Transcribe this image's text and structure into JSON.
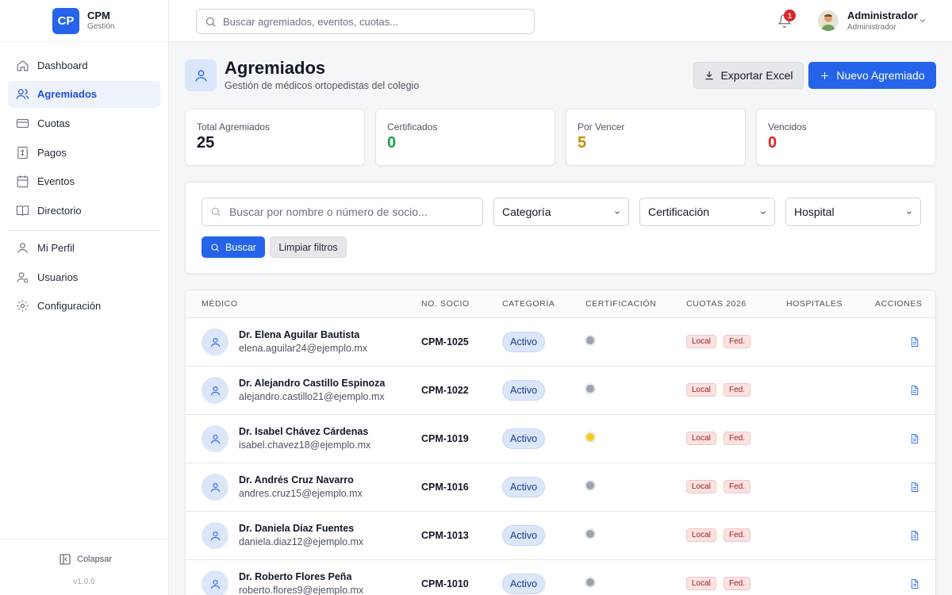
{
  "brand": {
    "logo": "CP",
    "name": "CPM",
    "subtitle": "Gestión"
  },
  "sidebar": {
    "items": [
      {
        "label": "Dashboard",
        "icon": "home-icon"
      },
      {
        "label": "Agremiados",
        "icon": "users-icon",
        "active": true
      },
      {
        "label": "Cuotas",
        "icon": "credit-card-icon"
      },
      {
        "label": "Pagos",
        "icon": "receipt-icon"
      },
      {
        "label": "Eventos",
        "icon": "calendar-icon"
      },
      {
        "label": "Directorio",
        "icon": "book-icon"
      },
      {
        "label": "Mi Perfil",
        "icon": "user-icon"
      },
      {
        "label": "Usuarios",
        "icon": "user-settings-icon"
      },
      {
        "label": "Configuración",
        "icon": "gear-icon"
      }
    ],
    "collapse_label": "Colapsar",
    "version": "v1.0.0"
  },
  "topbar": {
    "search_placeholder": "Buscar agremiados, eventos, cuotas...",
    "notifications_count": "1",
    "user_name": "Administrador",
    "user_role": "Administrador"
  },
  "header": {
    "title": "Agremiados",
    "subtitle": "Gestión de médicos ortopedistas del colegio",
    "export_label": "Exportar Excel",
    "new_label": "Nuevo Agremiado"
  },
  "stats": [
    {
      "label": "Total Agremiados",
      "value": "25",
      "color": "#111827"
    },
    {
      "label": "Certificados",
      "value": "0",
      "color": "#16a34a"
    },
    {
      "label": "Por Vencer",
      "value": "5",
      "color": "#ca8a04"
    },
    {
      "label": "Vencidos",
      "value": "0",
      "color": "#dc2626"
    }
  ],
  "filters": {
    "search_placeholder": "Buscar por nombre o número de socio...",
    "category": "Categoría",
    "certification": "Certificación",
    "hospital": "Hospital",
    "search_button": "Buscar",
    "clear_button": "Limpiar filtros"
  },
  "table": {
    "columns": [
      "MÉDICO",
      "NO. SOCIO",
      "CATEGORÍA",
      "CERTIFICACIÓN",
      "CUOTAS 2026",
      "HOSPITALES",
      "ACCIONES"
    ],
    "rows": [
      {
        "name": "Dr. Elena Aguilar Bautista",
        "email": "elena.aguilar24@ejemplo.mx",
        "socio": "CPM-1025",
        "categoria": "Activo",
        "cert_color": "#9ca3af",
        "cuota_local": "Local",
        "cuota_fed": "Fed."
      },
      {
        "name": "Dr. Alejandro Castillo Espinoza",
        "email": "alejandro.castillo21@ejemplo.mx",
        "socio": "CPM-1022",
        "categoria": "Activo",
        "cert_color": "#9ca3af",
        "cuota_local": "Local",
        "cuota_fed": "Fed."
      },
      {
        "name": "Dr. Isabel Chávez Cárdenas",
        "email": "isabel.chavez18@ejemplo.mx",
        "socio": "CPM-1019",
        "categoria": "Activo",
        "cert_color": "#facc15",
        "cuota_local": "Local",
        "cuota_fed": "Fed."
      },
      {
        "name": "Dr. Andrés Cruz Navarro",
        "email": "andres.cruz15@ejemplo.mx",
        "socio": "CPM-1016",
        "categoria": "Activo",
        "cert_color": "#9ca3af",
        "cuota_local": "Local",
        "cuota_fed": "Fed."
      },
      {
        "name": "Dr. Daniela Díaz Fuentes",
        "email": "daniela.diaz12@ejemplo.mx",
        "socio": "CPM-1013",
        "categoria": "Activo",
        "cert_color": "#9ca3af",
        "cuota_local": "Local",
        "cuota_fed": "Fed."
      },
      {
        "name": "Dr. Roberto Flores Peña",
        "email": "roberto.flores9@ejemplo.mx",
        "socio": "CPM-1010",
        "categoria": "Activo",
        "cert_color": "#9ca3af",
        "cuota_local": "Local",
        "cuota_fed": "Fed."
      }
    ]
  }
}
